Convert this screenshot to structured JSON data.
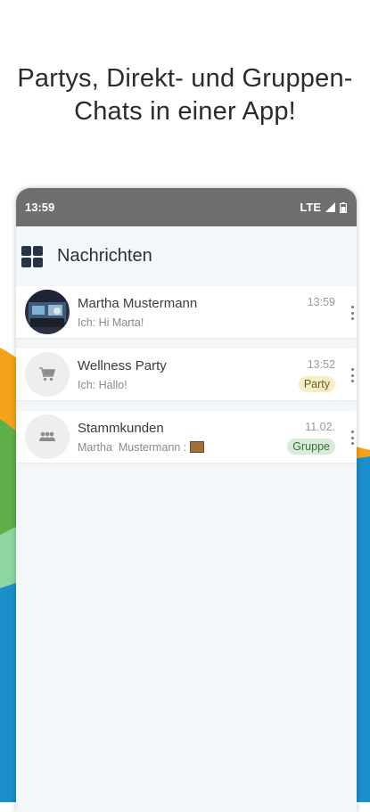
{
  "headline": {
    "line1": "Partys, Direkt- und Gruppen-",
    "line2": "Chats in einer App!"
  },
  "status_bar": {
    "time": "13:59",
    "network": "LTE",
    "icons": [
      "signal-icon",
      "battery-icon"
    ]
  },
  "app_bar": {
    "menu_icon": "grid-icon",
    "title": "Nachrichten"
  },
  "chats": [
    {
      "name": "Martha Mustermann",
      "preview": "Ich: Hi Marta!",
      "time": "13:59",
      "badge": null,
      "avatar": "photo"
    },
    {
      "name": "Wellness Party",
      "preview": "Ich: Hallo!",
      "time": "13:52",
      "badge": "Party",
      "avatar": "cart-icon"
    },
    {
      "name": "Stammkunden",
      "preview": "Martha  Mustermann :",
      "preview_attachment": "image-icon",
      "time": "11.02.",
      "badge": "Gruppe",
      "avatar": "group-icon"
    }
  ],
  "colors": {
    "status_bar": "#6f6f6f",
    "party_badge_bg": "#f6eec7",
    "party_badge_text": "#6d5d24",
    "gruppe_badge_bg": "#d8ebd7",
    "gruppe_badge_text": "#3d6b3c",
    "accent_orange": "#f5a21b",
    "accent_green": "#5fae4a",
    "accent_blue": "#1b8fcc"
  }
}
